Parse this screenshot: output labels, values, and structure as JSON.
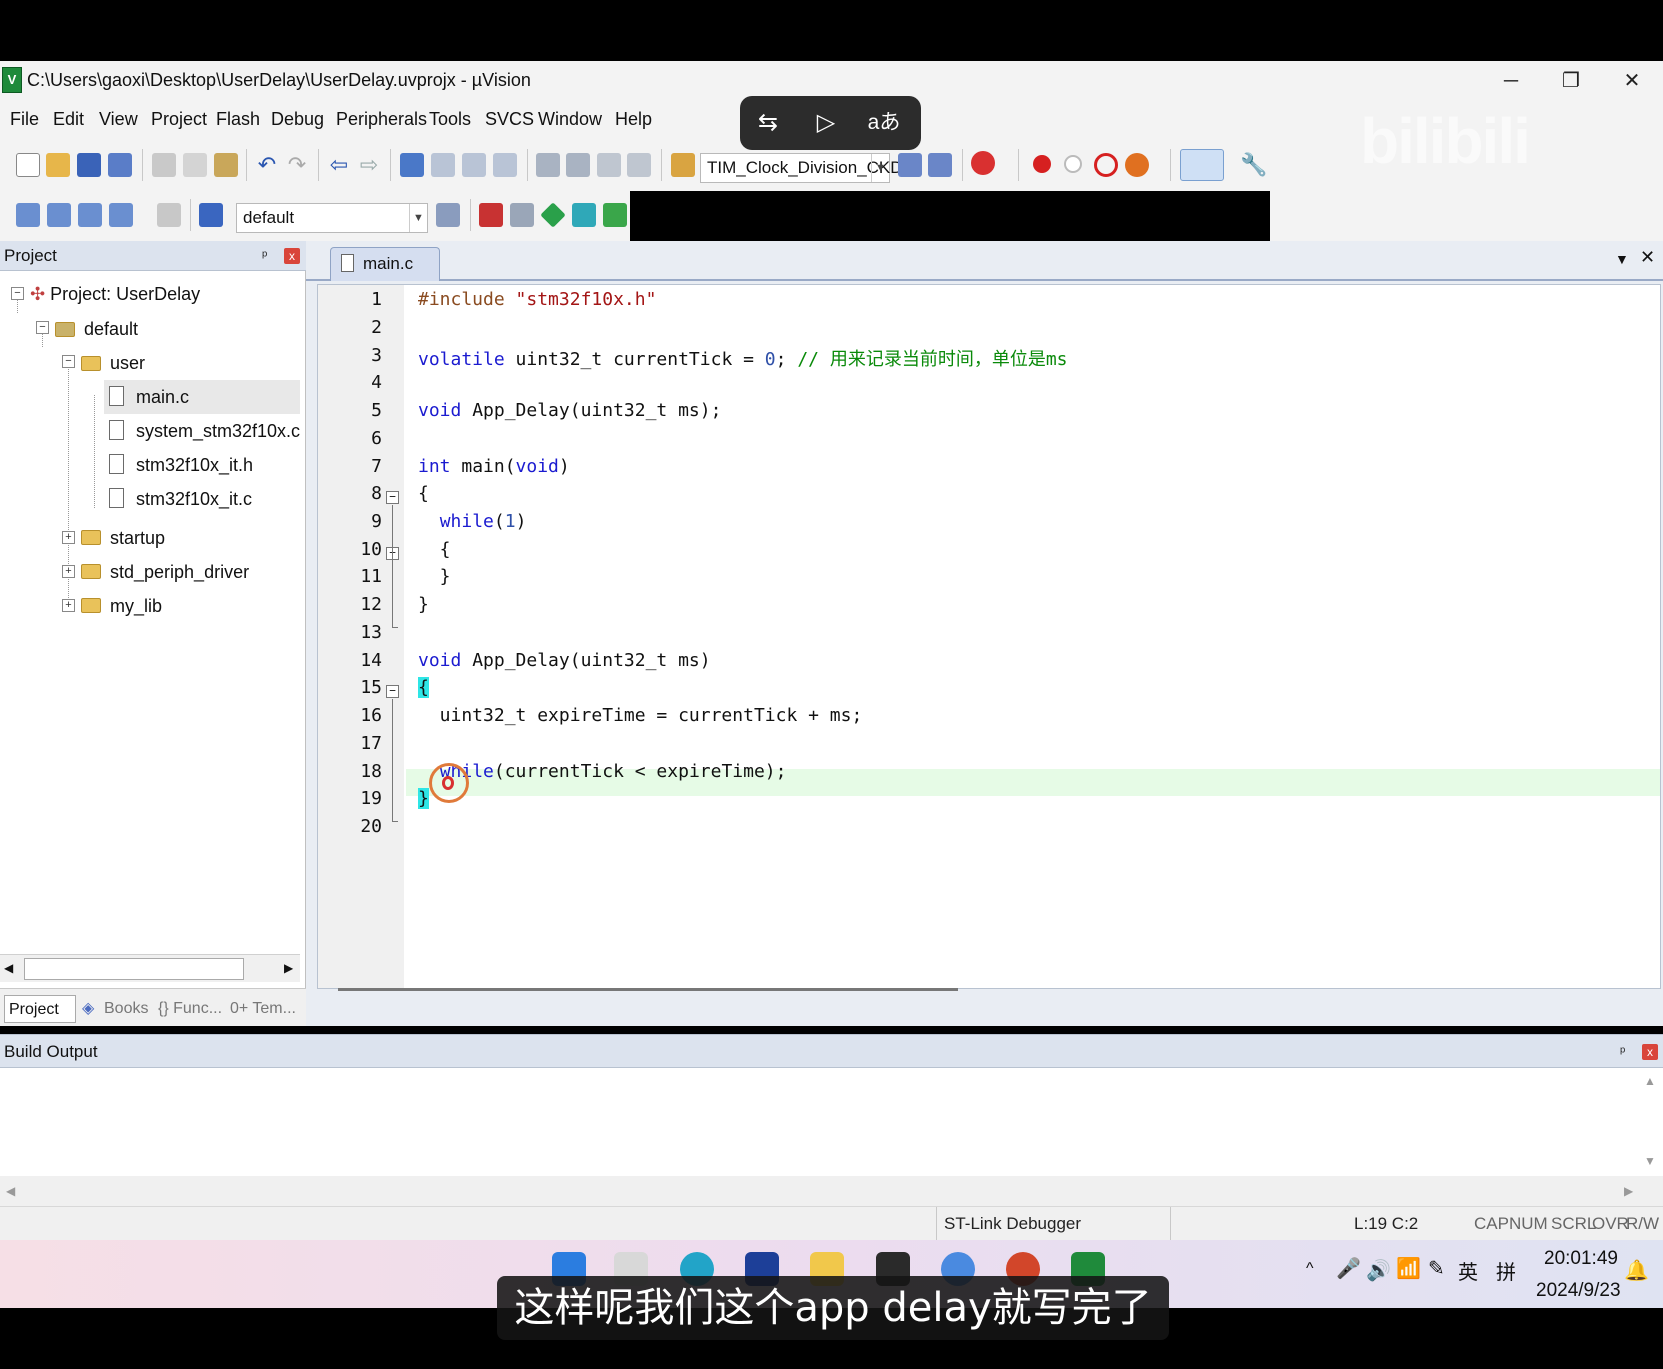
{
  "window": {
    "title": "C:\\Users\\gaoxi\\Desktop\\UserDelay\\UserDelay.uvprojx - µVision",
    "minimize": "─",
    "restore": "❐",
    "close": "✕"
  },
  "menu": [
    "File",
    "Edit",
    "View",
    "Project",
    "Flash",
    "Debug",
    "Peripherals",
    "Tools",
    "SVCS",
    "Window",
    "Help"
  ],
  "caption_tools": [
    "⇆",
    "▷",
    "aあ"
  ],
  "toolbar": {
    "target_combo": "TIM_Clock_Division_CKD",
    "build_target": "default"
  },
  "project_panel": {
    "title": "Project",
    "pin": "ᵖ",
    "close": "x",
    "tree": {
      "root": "Project: UserDelay",
      "target": "default",
      "group_user": "user",
      "files": [
        "main.c",
        "system_stm32f10x.c",
        "stm32f10x_it.h",
        "stm32f10x_it.c"
      ],
      "groups": [
        "startup",
        "std_periph_driver",
        "my_lib"
      ]
    },
    "tabs": [
      "Project",
      "Books",
      "{} Func...",
      "0+ Tem..."
    ]
  },
  "editor": {
    "tab": "main.c",
    "line_numbers": [
      "1",
      "2",
      "3",
      "4",
      "5",
      "6",
      "7",
      "8",
      "9",
      "10",
      "11",
      "12",
      "13",
      "14",
      "15",
      "16",
      "17",
      "18",
      "19",
      "20"
    ],
    "cursor_line": 19
  },
  "build_output": {
    "title": "Build Output"
  },
  "statusbar": {
    "debugger": "ST-Link Debugger",
    "position": "L:19 C:2",
    "flags": [
      "CAP",
      "NUM",
      "SCRL",
      "OVR",
      "R/W"
    ]
  },
  "taskbar": {
    "time": "20:01:49",
    "date": "2024/9/23",
    "ime_lang": "英",
    "ime_mode": "拼"
  },
  "subtitle": "这样呢我们这个app delay就写完了",
  "watermark": "bilibili",
  "colors": {
    "keyword": "#1b1bd0",
    "comment": "#0a8a0a",
    "string": "#a31515",
    "current_line": "#e6fbe6"
  }
}
